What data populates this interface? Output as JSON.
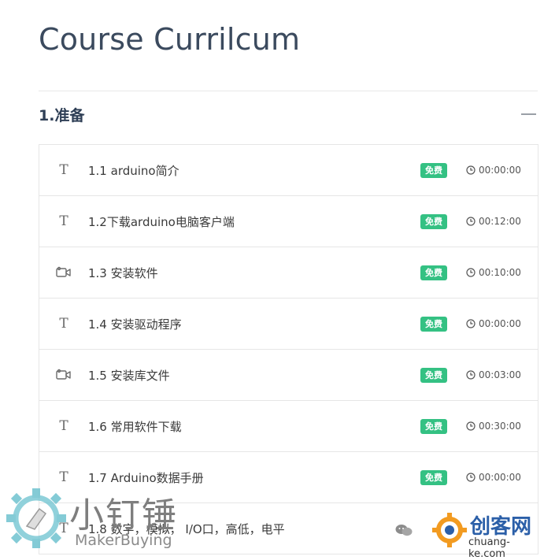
{
  "page_title": "Course Currilcum",
  "section": {
    "title": "1.准备"
  },
  "lessons": [
    {
      "icon": "text",
      "title": "1.1 arduino简介",
      "badge": "免费",
      "duration": "00:00:00"
    },
    {
      "icon": "text",
      "title": "1.2下载arduino电脑客户端",
      "badge": "免费",
      "duration": "00:12:00"
    },
    {
      "icon": "video",
      "title": "1.3 安装软件",
      "badge": "免费",
      "duration": "00:10:00"
    },
    {
      "icon": "text",
      "title": "1.4 安装驱动程序",
      "badge": "免费",
      "duration": "00:00:00"
    },
    {
      "icon": "video",
      "title": "1.5 安装库文件",
      "badge": "免费",
      "duration": "00:03:00"
    },
    {
      "icon": "text",
      "title": "1.6 常用软件下载",
      "badge": "免费",
      "duration": "00:30:00"
    },
    {
      "icon": "text",
      "title": "1.7 Arduino数据手册",
      "badge": "免费",
      "duration": "00:00:00"
    },
    {
      "icon": "text",
      "title": "1.8 数字，模拟， I/O口，高低，电平",
      "badge": "",
      "duration": ""
    }
  ],
  "watermark": {
    "left_cn": "小钉锤",
    "left_en": "MakerBuying",
    "right_cn": "创客网",
    "right_url": "chuang-ke.com"
  },
  "colors": {
    "accent_green": "#34c183",
    "title": "#3b4a5e"
  }
}
